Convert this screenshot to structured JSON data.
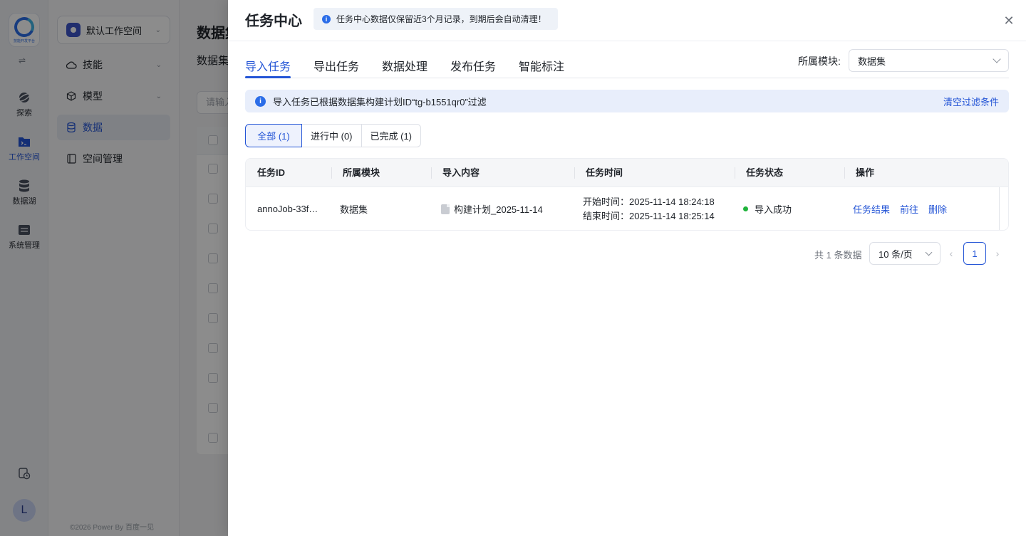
{
  "nav": {
    "logo_caption": "技能开发平台",
    "items": [
      {
        "label": "探索",
        "icon": "planet-icon"
      },
      {
        "label": "工作空间",
        "icon": "terminal-folder-icon"
      },
      {
        "label": "数据湖",
        "icon": "database-icon"
      },
      {
        "label": "系统管理",
        "icon": "settings-panel-icon"
      }
    ],
    "avatar_letter": "L"
  },
  "sidebar": {
    "workspace": "默认工作空间",
    "items": [
      {
        "label": "技能",
        "icon": "cloud-icon"
      },
      {
        "label": "模型",
        "icon": "cube-icon"
      },
      {
        "label": "数据",
        "icon": "database-icon"
      },
      {
        "label": "空间管理",
        "icon": "book-icon"
      }
    ],
    "footer": "©2026 Power By 百度一见"
  },
  "background": {
    "title": "数据集",
    "subtitle": "数据集",
    "search_placeholder": "请输入"
  },
  "drawer": {
    "title": "任务中心",
    "notice": "任务中心数据仅保留近3个月记录，到期后会自动清理！",
    "tabs": [
      "导入任务",
      "导出任务",
      "数据处理",
      "发布任务",
      "智能标注"
    ],
    "module_label": "所属模块:",
    "module_value": "数据集",
    "filter_text": "导入任务已根据数据集构建计划ID“tg-b1551qr0”过滤",
    "filter_clear": "清空过滤条件",
    "segments": [
      "全部 (1)",
      "进行中 (0)",
      "已完成 (1)"
    ],
    "columns": [
      "任务ID",
      "所属模块",
      "导入内容",
      "任务时间",
      "任务状态",
      "操作"
    ],
    "rows": [
      {
        "id": "annoJob-33f…",
        "module": "数据集",
        "content": "构建计划_2025-11-14",
        "start": "开始时间：2025-11-14 18:24:18",
        "end": "结束时间：2025-11-14 18:25:14",
        "status": "导入成功",
        "status_color": "#1fb33b",
        "actions": [
          "任务结果",
          "前往",
          "删除"
        ]
      }
    ],
    "pagination": {
      "total": "共 1 条数据",
      "page_size": "10 条/页",
      "current": "1"
    }
  },
  "colors": {
    "primary": "#2455d6",
    "success": "#1fb33b"
  }
}
